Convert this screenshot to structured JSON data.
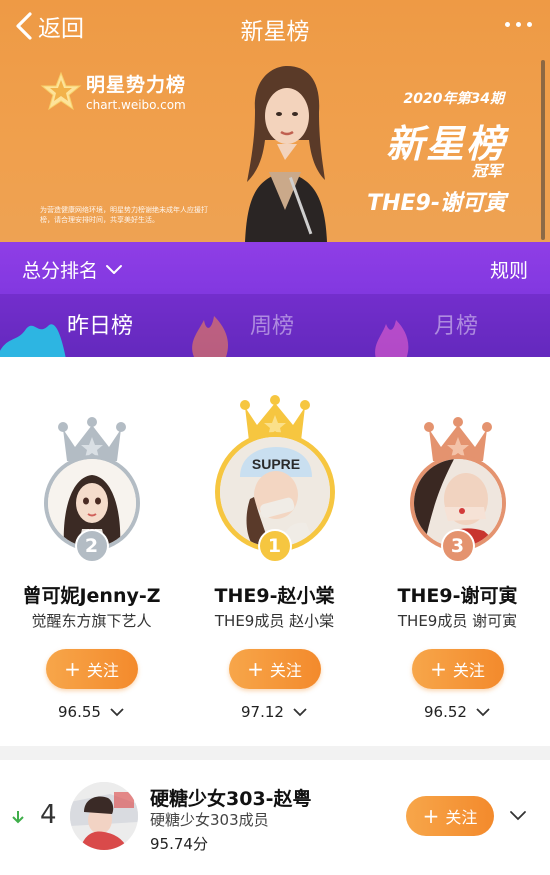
{
  "nav": {
    "back_label": "返回",
    "title": "新星榜"
  },
  "banner": {
    "logo_name": "明星势力榜",
    "logo_url": "chart.weibo.com",
    "notice": "为营造健康网络环境，明星势力榜谢绝未成年人应援打榜，请合理安排时间，共享美好生活。",
    "issue": "2020年第34期",
    "board_title": "新星榜",
    "champion_label": "冠军",
    "winner": "THE9-谢可寅"
  },
  "ranking": {
    "sort_label": "总分排名",
    "rules_label": "规则",
    "tabs": [
      {
        "label": "昨日榜",
        "active": true
      },
      {
        "label": "周榜",
        "active": false
      },
      {
        "label": "月榜",
        "active": false
      }
    ]
  },
  "podium": [
    {
      "rank": "2",
      "name": "曾可妮Jenny-Z",
      "desc": "觉醒东方旗下艺人",
      "follow_label": "关注",
      "score": "96.55"
    },
    {
      "rank": "1",
      "name": "THE9-赵小棠",
      "desc": "THE9成员 赵小棠",
      "follow_label": "关注",
      "score": "97.12"
    },
    {
      "rank": "3",
      "name": "THE9-谢可寅",
      "desc": "THE9成员 谢可寅",
      "follow_label": "关注",
      "score": "96.52"
    }
  ],
  "list": [
    {
      "rank": "4",
      "trend": "down",
      "name": "硬糖少女303-赵粤",
      "desc": "硬糖少女303成员",
      "score": "95.74分",
      "follow_label": "关注"
    }
  ],
  "colors": {
    "banner_orange": "#ee9a45",
    "purple": "#8238e0",
    "gold": "#f6c640",
    "silver": "#b3bcc4",
    "bronze": "#e4936f",
    "follow_orange": "#f38a2c",
    "trend_down": "#3fae4a"
  },
  "icons": {
    "back": "chevron-left-icon",
    "more": "more-dots-icon",
    "dropdown": "chevron-down-icon",
    "crown": "crown-icon",
    "trend": "arrow-down-icon"
  }
}
